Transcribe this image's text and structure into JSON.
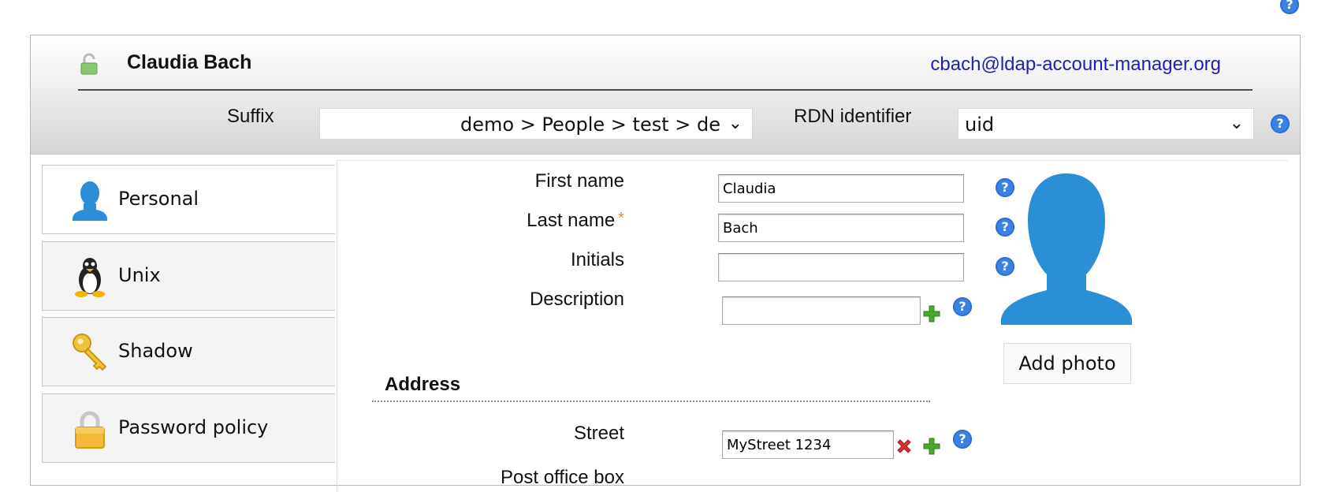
{
  "help_icon_glyph": "?",
  "header": {
    "user_name": "Claudia Bach",
    "email": "cbach@ldap-account-manager.org",
    "suffix_label": "Suffix",
    "suffix_value": "demo > People > test > de",
    "rdn_label": "RDN identifier",
    "rdn_value": "uid",
    "lock_icon": "lock-open-icon"
  },
  "tabs": [
    {
      "label": "Personal",
      "icon": "person-icon",
      "active": true
    },
    {
      "label": "Unix",
      "icon": "tux-penguin-icon",
      "active": false
    },
    {
      "label": "Shadow",
      "icon": "key-icon",
      "active": false
    },
    {
      "label": "Password policy",
      "icon": "padlock-icon",
      "active": false
    }
  ],
  "form": {
    "first_name": {
      "label": "First name",
      "value": "Claudia"
    },
    "last_name": {
      "label": "Last name",
      "value": "Bach",
      "required_marker": "*"
    },
    "initials": {
      "label": "Initials",
      "value": ""
    },
    "description": {
      "label": "Description",
      "value": ""
    },
    "address_section": "Address",
    "street": {
      "label": "Street",
      "value": "MyStreet 1234"
    },
    "post_office_box": {
      "label": "Post office box"
    },
    "add_photo_label": "Add photo"
  },
  "colors": {
    "help_blue": "#3b82e4",
    "avatar_blue": "#2b8fd6",
    "email_link": "#1f1fb4",
    "required_orange": "#f08b22",
    "add_green": "#4aa82c",
    "remove_red": "#d8302f"
  }
}
